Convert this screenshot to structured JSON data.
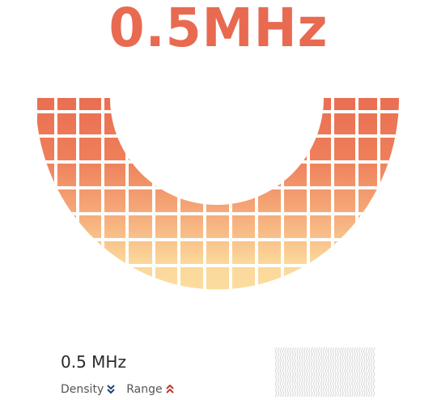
{
  "headline": {
    "value": "0.5MHz",
    "color": "#e86a50"
  },
  "readout": {
    "frequency_label": "0.5 MHz"
  },
  "legend": {
    "density": {
      "label": "Density",
      "direction": "down",
      "icon": "double-chevron-down-icon",
      "color": "#1f3f7a"
    },
    "range": {
      "label": "Range",
      "direction": "up",
      "icon": "double-chevron-up-icon",
      "color": "#c0392b"
    }
  },
  "coverage_arc": {
    "gradient_colors": [
      "#e86a50",
      "#f49a70",
      "#fbd79a",
      "#fde6a8"
    ]
  }
}
